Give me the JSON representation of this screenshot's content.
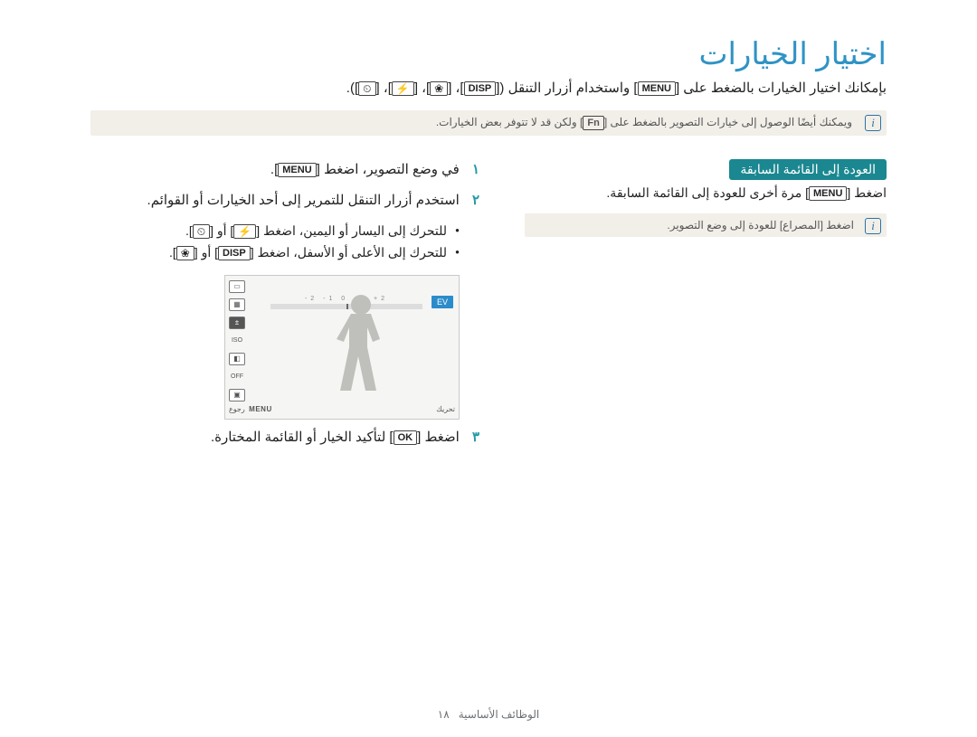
{
  "title": "اختيار الخيارات",
  "intro": {
    "prefix": "بإمكانك اختيار الخيارات بالضغط على [",
    "menu": "MENU",
    "mid1": "] واستخدام أزرار التنقل ([",
    "disp": "DISP",
    "sep": "]، [",
    "macro_sym": "❀",
    "flash_sym": "⚡",
    "timer_sym": "⏲",
    "suffix": "])."
  },
  "note": {
    "text_pre": "ويمكنك أيضًا الوصول إلى خيارات التصوير بالضغط على [",
    "fn": "Fn",
    "text_post": "] ولكن قد لا تتوفر بعض الخيارات."
  },
  "steps": {
    "n1": "١",
    "n2": "٢",
    "n3": "٣",
    "s1_pre": "في وضع التصوير، اضغط [",
    "s1_menu": "MENU",
    "s1_post": "].",
    "s2": "استخدم أزرار التنقل للتمرير إلى أحد الخيارات أو القوائم.",
    "b1_pre": "للتحرك إلى اليسار أو اليمين، اضغط [",
    "b1_or": "] أو [",
    "b1_post": "].",
    "b2_pre": "للتحرك إلى الأعلى أو الأسفل، اضغط [",
    "b2_disp": "DISP",
    "b2_post": "].",
    "s3_pre": "اضغط [",
    "s3_ok": "OK",
    "s3_post": "] لتأكيد الخيار أو القائمة المختارة."
  },
  "screen": {
    "scale": "-2   -1    0    +1   +2",
    "ev": "EV",
    "left_label": "تحريك",
    "right_label": "رجوع",
    "menu_label": "MENU",
    "side": {
      "iso": "ISO",
      "off": "OFF"
    }
  },
  "prev": {
    "heading": "العودة إلى القائمة السابقة",
    "text_pre": "اضغط [",
    "menu": "MENU",
    "text_post": "] مرة أخرى للعودة إلى القائمة السابقة."
  },
  "shutter_note": "اضغط [المصراع] للعودة إلى وضع التصوير.",
  "footer": {
    "label": "الوظائف الأساسية",
    "page": "١٨"
  }
}
